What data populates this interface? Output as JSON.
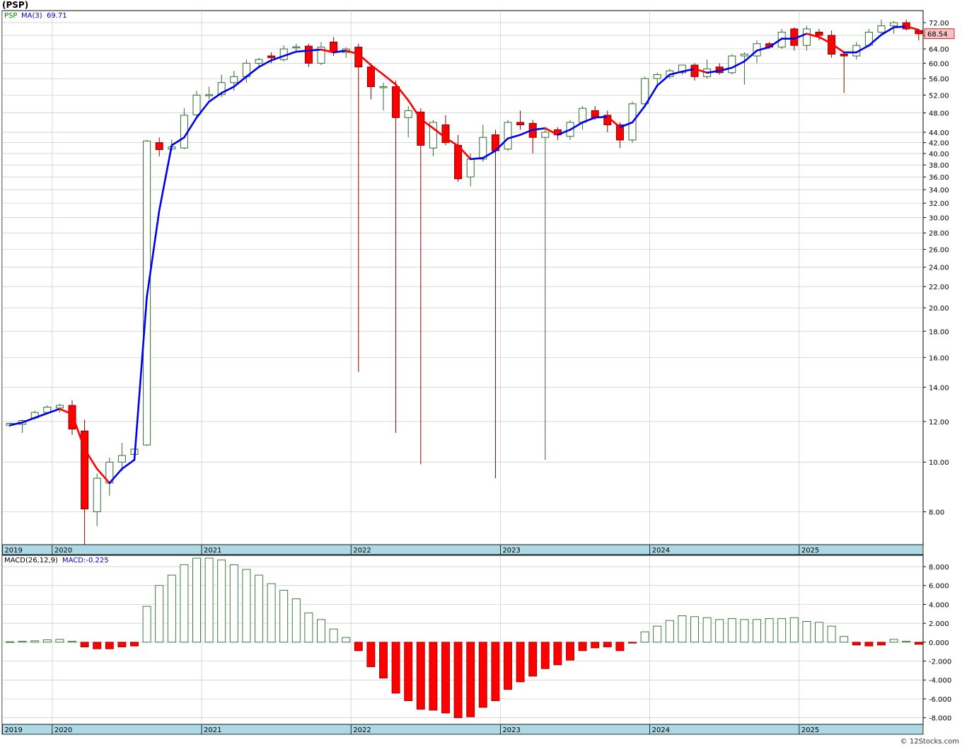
{
  "title": "(PSP)",
  "credit": "© 12Stocks.com",
  "colors": {
    "up": "#2f6b2f",
    "down": "#ff0000",
    "ma_up": "#0000ee",
    "ma_down": "#ff0000",
    "grid": "#c8c8c8",
    "axis_band": "#add8e6"
  },
  "chart_data": [
    {
      "type": "candlestick",
      "title": "PSP",
      "legend": {
        "symbol": "PSP",
        "ma_label": "MA(3)",
        "ma_value": "69.71"
      },
      "last_price_label": "68.54",
      "y_scale": "log",
      "ylim": [
        6.9,
        76
      ],
      "y_ticks": [
        8,
        10,
        12,
        14,
        16,
        18,
        20,
        22,
        24,
        26,
        28,
        30,
        32,
        34,
        36,
        38,
        40,
        42,
        44,
        48,
        52,
        56,
        60,
        64,
        68,
        72
      ],
      "y_tick_labels": [
        "8.00",
        "10.00",
        "12.00",
        "14.00",
        "16.00",
        "18.00",
        "20.00",
        "22.00",
        "24.00",
        "26.00",
        "28.00",
        "30.00",
        "32.00",
        "34.00",
        "36.00",
        "38.00",
        "40.00",
        "42.00",
        "44.00",
        "48.00",
        "52.00",
        "56.00",
        "60.00",
        "64.00",
        "68.00",
        "72.00"
      ],
      "x_labels": [
        {
          "label": "2019",
          "index": -0.6
        },
        {
          "label": "2020",
          "index": 3.4
        },
        {
          "label": "2021",
          "index": 15.4
        },
        {
          "label": "2022",
          "index": 27.4
        },
        {
          "label": "2023",
          "index": 39.4
        },
        {
          "label": "2024",
          "index": 51.4
        },
        {
          "label": "2025",
          "index": 63.4
        }
      ],
      "candles": [
        {
          "o": 11.8,
          "h": 11.95,
          "l": 11.7,
          "c": 11.9
        },
        {
          "o": 11.85,
          "h": 12.1,
          "l": 11.4,
          "c": 12.05
        },
        {
          "o": 12.2,
          "h": 12.6,
          "l": 12.1,
          "c": 12.5
        },
        {
          "o": 12.5,
          "h": 12.9,
          "l": 12.4,
          "c": 12.8
        },
        {
          "o": 12.75,
          "h": 13.0,
          "l": 12.5,
          "c": 12.9
        },
        {
          "o": 12.9,
          "h": 13.2,
          "l": 11.3,
          "c": 11.6
        },
        {
          "o": 11.5,
          "h": 12.1,
          "l": 6.9,
          "c": 8.1
        },
        {
          "o": 8.0,
          "h": 9.5,
          "l": 7.5,
          "c": 9.3
        },
        {
          "o": 9.1,
          "h": 10.2,
          "l": 8.6,
          "c": 10.0
        },
        {
          "o": 10.0,
          "h": 10.9,
          "l": 9.6,
          "c": 10.3
        },
        {
          "o": 10.35,
          "h": 10.6,
          "l": 10.1,
          "c": 10.6
        },
        {
          "o": 10.8,
          "h": 42.5,
          "l": 10.75,
          "c": 42.3
        },
        {
          "o": 42.0,
          "h": 43.0,
          "l": 39.5,
          "c": 40.7
        },
        {
          "o": 40.8,
          "h": 42.6,
          "l": 40.5,
          "c": 41.2
        },
        {
          "o": 41.0,
          "h": 49.0,
          "l": 40.8,
          "c": 47.5
        },
        {
          "o": 47.6,
          "h": 53.0,
          "l": 47.0,
          "c": 52.0
        },
        {
          "o": 52.0,
          "h": 54.0,
          "l": 51.0,
          "c": 52.1
        },
        {
          "o": 52.1,
          "h": 57.0,
          "l": 51.5,
          "c": 55.0
        },
        {
          "o": 55.0,
          "h": 58.0,
          "l": 53.0,
          "c": 56.5
        },
        {
          "o": 56.5,
          "h": 61.0,
          "l": 55.0,
          "c": 60.0
        },
        {
          "o": 60.0,
          "h": 61.5,
          "l": 59.0,
          "c": 61.0
        },
        {
          "o": 62.0,
          "h": 63.0,
          "l": 60.0,
          "c": 61.5
        },
        {
          "o": 61.0,
          "h": 65.0,
          "l": 60.5,
          "c": 64.0
        },
        {
          "o": 64.5,
          "h": 65.5,
          "l": 63.5,
          "c": 64.6
        },
        {
          "o": 64.8,
          "h": 65.5,
          "l": 59.0,
          "c": 60.0
        },
        {
          "o": 60.0,
          "h": 66.0,
          "l": 59.5,
          "c": 64.5
        },
        {
          "o": 66.0,
          "h": 67.5,
          "l": 62.0,
          "c": 63.0
        },
        {
          "o": 63.0,
          "h": 64.5,
          "l": 61.5,
          "c": 64.0
        },
        {
          "o": 64.5,
          "h": 65.5,
          "l": 15.0,
          "c": 59.0
        },
        {
          "o": 59.0,
          "h": 60.0,
          "l": 51.0,
          "c": 54.0
        },
        {
          "o": 54.0,
          "h": 55.0,
          "l": 48.5,
          "c": 54.0
        },
        {
          "o": 54.0,
          "h": 55.5,
          "l": 11.4,
          "c": 47.0
        },
        {
          "o": 47.0,
          "h": 49.5,
          "l": 43.0,
          "c": 48.5
        },
        {
          "o": 48.2,
          "h": 49.0,
          "l": 9.9,
          "c": 41.5
        },
        {
          "o": 41.0,
          "h": 46.5,
          "l": 39.5,
          "c": 46.0
        },
        {
          "o": 45.5,
          "h": 47.5,
          "l": 41.5,
          "c": 42.0
        },
        {
          "o": 41.5,
          "h": 43.5,
          "l": 35.2,
          "c": 35.7
        },
        {
          "o": 36.0,
          "h": 40.0,
          "l": 34.5,
          "c": 39.0
        },
        {
          "o": 39.0,
          "h": 45.5,
          "l": 38.5,
          "c": 43.0
        },
        {
          "o": 43.5,
          "h": 44.5,
          "l": 9.3,
          "c": 40.5
        },
        {
          "o": 40.8,
          "h": 46.5,
          "l": 40.5,
          "c": 46.0
        },
        {
          "o": 46.0,
          "h": 48.5,
          "l": 44.5,
          "c": 45.5
        },
        {
          "o": 45.8,
          "h": 46.5,
          "l": 40.0,
          "c": 43.0
        },
        {
          "o": 43.0,
          "h": 44.5,
          "l": 10.1,
          "c": 44.0
        },
        {
          "o": 44.5,
          "h": 45.0,
          "l": 42.5,
          "c": 43.5
        },
        {
          "o": 43.2,
          "h": 46.5,
          "l": 42.5,
          "c": 46.0
        },
        {
          "o": 46.0,
          "h": 49.5,
          "l": 44.5,
          "c": 49.0
        },
        {
          "o": 48.5,
          "h": 49.5,
          "l": 46.5,
          "c": 47.0
        },
        {
          "o": 47.5,
          "h": 48.5,
          "l": 44.0,
          "c": 45.5
        },
        {
          "o": 45.5,
          "h": 46.0,
          "l": 41.0,
          "c": 42.5
        },
        {
          "o": 42.5,
          "h": 50.5,
          "l": 42.0,
          "c": 50.0
        },
        {
          "o": 50.0,
          "h": 56.5,
          "l": 49.5,
          "c": 56.0
        },
        {
          "o": 56.0,
          "h": 57.5,
          "l": 54.5,
          "c": 57.0
        },
        {
          "o": 56.5,
          "h": 58.5,
          "l": 56.0,
          "c": 58.0
        },
        {
          "o": 57.5,
          "h": 59.5,
          "l": 57.0,
          "c": 59.5
        },
        {
          "o": 59.5,
          "h": 60.0,
          "l": 55.5,
          "c": 56.5
        },
        {
          "o": 56.5,
          "h": 61.0,
          "l": 56.0,
          "c": 58.5
        },
        {
          "o": 59.0,
          "h": 60.0,
          "l": 57.0,
          "c": 57.5
        },
        {
          "o": 57.5,
          "h": 62.5,
          "l": 57.0,
          "c": 62.0
        },
        {
          "o": 62.0,
          "h": 63.0,
          "l": 54.5,
          "c": 62.5
        },
        {
          "o": 62.0,
          "h": 66.5,
          "l": 60.0,
          "c": 65.5
        },
        {
          "o": 65.5,
          "h": 66.0,
          "l": 64.0,
          "c": 64.5
        },
        {
          "o": 64.5,
          "h": 70.0,
          "l": 64.0,
          "c": 69.0
        },
        {
          "o": 70.0,
          "h": 70.5,
          "l": 63.5,
          "c": 65.0
        },
        {
          "o": 65.0,
          "h": 71.0,
          "l": 63.5,
          "c": 70.0
        },
        {
          "o": 69.0,
          "h": 70.0,
          "l": 66.5,
          "c": 68.0
        },
        {
          "o": 68.0,
          "h": 69.5,
          "l": 61.5,
          "c": 62.5
        },
        {
          "o": 62.5,
          "h": 63.0,
          "l": 52.5,
          "c": 62.0
        },
        {
          "o": 62.0,
          "h": 66.0,
          "l": 61.0,
          "c": 65.0
        },
        {
          "o": 65.0,
          "h": 70.0,
          "l": 64.5,
          "c": 69.0
        },
        {
          "o": 69.0,
          "h": 73.0,
          "l": 68.0,
          "c": 71.0
        },
        {
          "o": 71.0,
          "h": 72.5,
          "l": 68.5,
          "c": 72.0
        },
        {
          "o": 72.0,
          "h": 73.0,
          "l": 69.5,
          "c": 70.0
        },
        {
          "o": 69.5,
          "h": 70.0,
          "l": 66.5,
          "c": 68.5
        }
      ],
      "ma": [
        11.8,
        11.95,
        12.2,
        12.45,
        12.7,
        12.4,
        10.6,
        9.7,
        9.1,
        9.7,
        10.1,
        21.0,
        31.0,
        41.5,
        43.0,
        47.0,
        50.5,
        52.5,
        54.0,
        56.5,
        59.0,
        60.8,
        62.0,
        63.2,
        63.5,
        63.8,
        63.0,
        63.5,
        62.5,
        59.5,
        57.0,
        54.5,
        50.8,
        46.7,
        44.8,
        42.9,
        41.4,
        39.0,
        39.2,
        40.5,
        42.8,
        43.5,
        44.5,
        44.8,
        43.5,
        44.5,
        46.0,
        47.0,
        47.2,
        45.0,
        46.0,
        49.5,
        54.3,
        57.0,
        57.8,
        58.5,
        57.5,
        58.0,
        58.8,
        60.5,
        63.5,
        64.5,
        67.0,
        67.0,
        68.5,
        67.5,
        65.5,
        63.0,
        63.0,
        65.0,
        68.2,
        70.5,
        70.8,
        69.7
      ]
    },
    {
      "type": "bar",
      "title": "MACD",
      "legend": {
        "params_label": "MACD(26,12,9)",
        "value_label": "MACD:-0.225"
      },
      "ylim": [
        -8.7,
        9.2
      ],
      "y_ticks": [
        -8,
        -6,
        -4,
        -2,
        0,
        2,
        4,
        6,
        8
      ],
      "y_tick_labels": [
        "-8.000",
        "-6.000",
        "-4.000",
        "-2.000",
        "0.000",
        "2.000",
        "4.000",
        "6.000",
        "8.000"
      ],
      "x_labels": [
        {
          "label": "2019",
          "index": -0.6
        },
        {
          "label": "2020",
          "index": 3.4
        },
        {
          "label": "2021",
          "index": 15.4
        },
        {
          "label": "2022",
          "index": 27.4
        },
        {
          "label": "2023",
          "index": 39.4
        },
        {
          "label": "2024",
          "index": 51.4
        },
        {
          "label": "2025",
          "index": 63.4
        }
      ],
      "values": [
        0.05,
        0.1,
        0.15,
        0.25,
        0.3,
        0.1,
        -0.5,
        -0.7,
        -0.7,
        -0.5,
        -0.4,
        3.8,
        6.0,
        7.1,
        8.2,
        8.9,
        8.9,
        8.7,
        8.2,
        7.7,
        7.1,
        6.2,
        5.5,
        4.6,
        3.1,
        2.4,
        1.4,
        0.5,
        -0.9,
        -2.6,
        -3.8,
        -5.4,
        -6.2,
        -7.1,
        -7.2,
        -7.5,
        -8.0,
        -7.9,
        -6.9,
        -6.2,
        -5.0,
        -4.2,
        -3.6,
        -2.8,
        -2.4,
        -1.9,
        -0.9,
        -0.6,
        -0.5,
        -0.9,
        -0.1,
        1.1,
        1.7,
        2.3,
        2.8,
        2.7,
        2.6,
        2.4,
        2.5,
        2.4,
        2.4,
        2.5,
        2.5,
        2.6,
        2.2,
        2.1,
        1.7,
        0.6,
        -0.3,
        -0.4,
        -0.3,
        0.3,
        0.1,
        -0.225
      ]
    }
  ]
}
